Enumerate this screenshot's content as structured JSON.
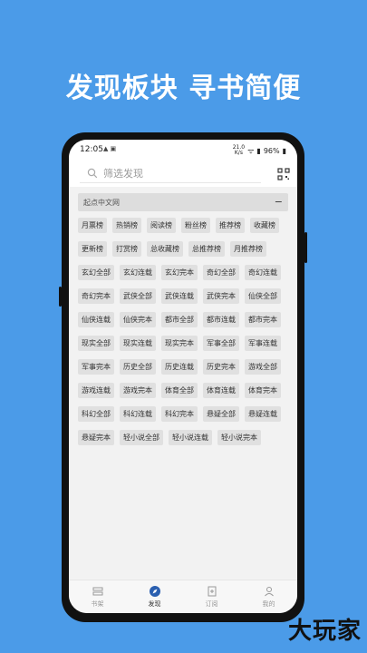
{
  "headline": "发现板块  寻书简便",
  "status": {
    "time": "12:05",
    "speed": "21.0\nK/s",
    "battery": "96%"
  },
  "search": {
    "placeholder": "筛选发现"
  },
  "section": {
    "title": "起点中文网",
    "collapse": "−"
  },
  "tags": [
    "月票榜",
    "热销榜",
    "阅读榜",
    "粉丝榜",
    "推荐榜",
    "收藏榜",
    "更新榜",
    "打赏榜",
    "总收藏榜",
    "总推荐榜",
    "月推荐榜",
    "玄幻全部",
    "玄幻连载",
    "玄幻完本",
    "奇幻全部",
    "奇幻连载",
    "奇幻完本",
    "武侠全部",
    "武侠连载",
    "武侠完本",
    "仙侠全部",
    "仙侠连载",
    "仙侠完本",
    "都市全部",
    "都市连载",
    "都市完本",
    "现实全部",
    "现实连载",
    "现实完本",
    "军事全部",
    "军事连载",
    "军事完本",
    "历史全部",
    "历史连载",
    "历史完本",
    "游戏全部",
    "游戏连载",
    "游戏完本",
    "体育全部",
    "体育连载",
    "体育完本",
    "科幻全部",
    "科幻连载",
    "科幻完本",
    "悬疑全部",
    "悬疑连载",
    "悬疑完本",
    "轻小说全部",
    "轻小说连载",
    "轻小说完本"
  ],
  "tabs": [
    {
      "label": "书架",
      "icon": "bookshelf-icon"
    },
    {
      "label": "发现",
      "icon": "compass-icon",
      "active": true
    },
    {
      "label": "订阅",
      "icon": "subscribe-icon"
    },
    {
      "label": "我的",
      "icon": "user-icon"
    }
  ],
  "watermark": "大玩家"
}
